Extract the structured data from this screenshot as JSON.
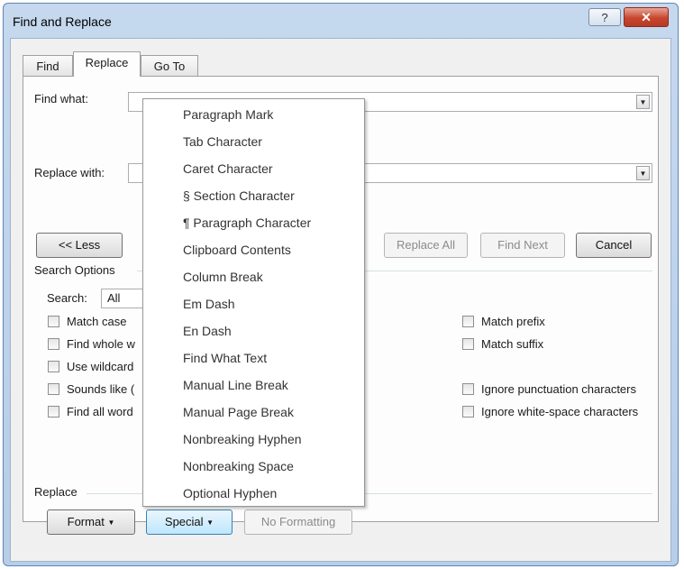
{
  "window": {
    "title": "Find and Replace",
    "help_glyph": "?",
    "close_glyph": "✕"
  },
  "tabs": [
    {
      "label": "Find"
    },
    {
      "label": "Replace"
    },
    {
      "label": "Go To"
    }
  ],
  "find_what": {
    "label": "Find what:",
    "value": ""
  },
  "replace_with": {
    "label": "Replace with:",
    "value": ""
  },
  "buttons": {
    "less": "<< Less",
    "replace_all": "Replace All",
    "find_next": "Find Next",
    "cancel": "Cancel",
    "format": "Format",
    "special": "Special",
    "no_formatting": "No Formatting"
  },
  "search_options": {
    "heading": "Search Options",
    "search_label": "Search:",
    "search_value": "All",
    "left_options": [
      {
        "label": "Match case",
        "checked": false
      },
      {
        "label": "Find whole w",
        "checked": false
      },
      {
        "label": "Use wildcard",
        "checked": false
      },
      {
        "label": "Sounds like (",
        "checked": false
      },
      {
        "label": "Find all word",
        "checked": false
      }
    ],
    "right_options": [
      {
        "label": "Match prefix",
        "checked": false
      },
      {
        "label": "Match suffix",
        "checked": false
      },
      {
        "label": "Ignore punctuation characters",
        "checked": false
      },
      {
        "label": "Ignore white-space characters",
        "checked": false
      }
    ]
  },
  "replace_section": {
    "heading": "Replace"
  },
  "special_menu": {
    "items": [
      "Paragraph Mark",
      "Tab Character",
      "Caret Character",
      "§ Section Character",
      "¶ Paragraph Character",
      "Clipboard Contents",
      "Column Break",
      "Em Dash",
      "En Dash",
      "Find What Text",
      "Manual Line Break",
      "Manual Page Break",
      "Nonbreaking Hyphen",
      "Nonbreaking Space",
      "Optional Hyphen"
    ]
  },
  "colors": {
    "title_bar": "#c5d8ee",
    "close_button": "#c7462f",
    "special_button_accent": "#bee6fd"
  }
}
